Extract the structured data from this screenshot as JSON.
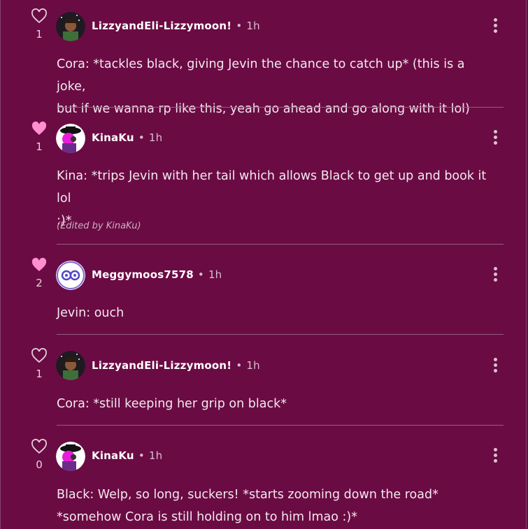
{
  "comments": [
    {
      "likes": "1",
      "liked": false,
      "author": "LizzyandEli-Lizzymoon!",
      "separator": "•",
      "time": "1h",
      "lines": [
        "Cora: *tackles black, giving Jevin the chance to catch up* (this is a joke,",
        "but if we wanna rp like this, yeah go ahead and go along with it lol)"
      ],
      "avatar": "avatar-lizzy"
    },
    {
      "likes": "1",
      "liked": true,
      "author": "KinaKu",
      "separator": "•",
      "time": "1h",
      "lines": [
        "Kina: *trips Jevin with her tail which allows Black to get up and book it lol",
        ":)*"
      ],
      "edited": "(Edited by KinaKu)",
      "avatar": "avatar-kinaku"
    },
    {
      "likes": "2",
      "liked": true,
      "author": "Meggymoos7578",
      "separator": "•",
      "time": "1h",
      "lines": [
        "Jevin: ouch"
      ],
      "avatar": "avatar-meggy"
    },
    {
      "likes": "1",
      "liked": false,
      "author": "LizzyandEli-Lizzymoon!",
      "separator": "•",
      "time": "1h",
      "lines": [
        "Cora: *still keeping her grip on black*"
      ],
      "avatar": "avatar-lizzy"
    },
    {
      "likes": "0",
      "liked": false,
      "author": "KinaKu",
      "separator": "•",
      "time": "1h",
      "lines": [
        "Black: Welp, so long, suckers! *starts zooming down the road*",
        "*somehow Cora is still holding on to him lmao :)*"
      ],
      "avatar": "avatar-kinaku"
    }
  ],
  "colors": {
    "background": "#6b0b43",
    "liked_heart": "#ff8fd0",
    "divider": "#955e83"
  }
}
